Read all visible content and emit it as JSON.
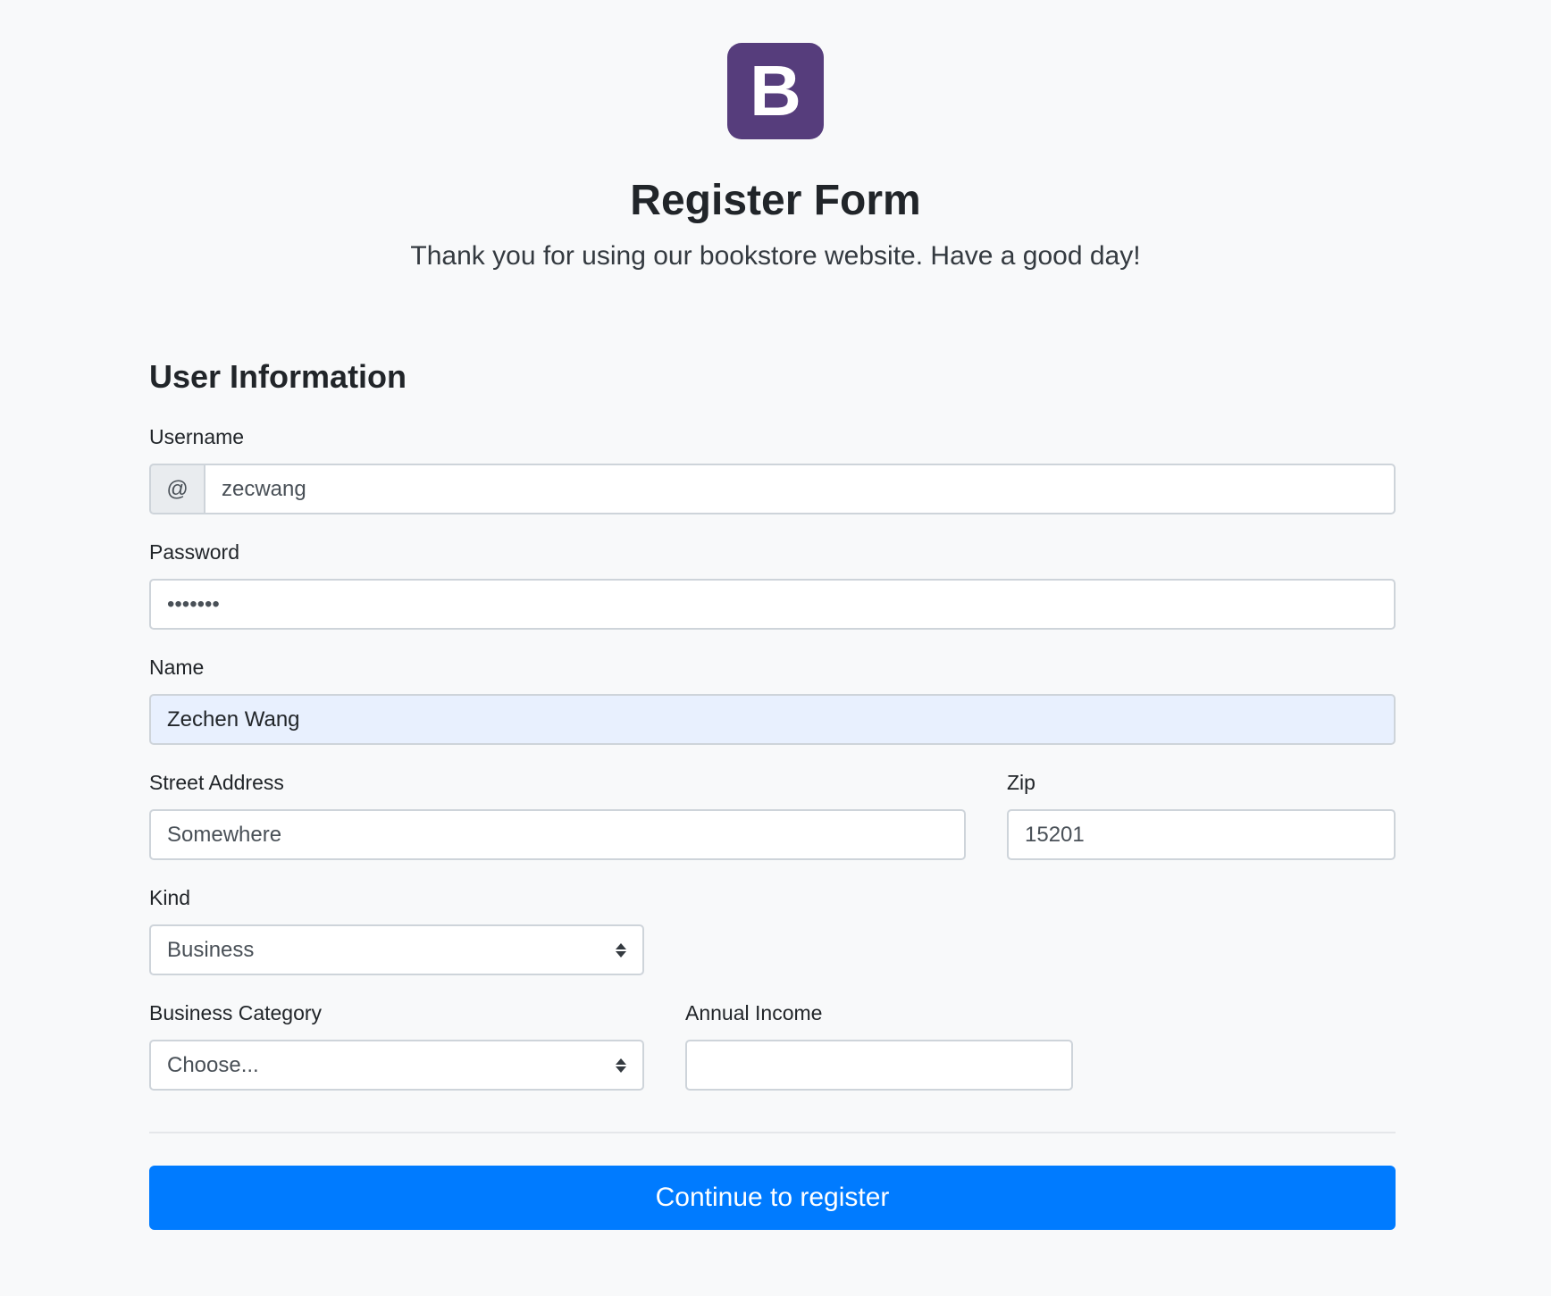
{
  "header": {
    "logo_letter": "B",
    "title": "Register Form",
    "subtitle": "Thank you for using our bookstore website. Have a good day!"
  },
  "section": {
    "title": "User Information"
  },
  "fields": {
    "username": {
      "label": "Username",
      "prefix": "@",
      "value": "zecwang"
    },
    "password": {
      "label": "Password",
      "value": "•••••••"
    },
    "name": {
      "label": "Name",
      "value": "Zechen Wang"
    },
    "street": {
      "label": "Street Address",
      "value": "Somewhere"
    },
    "zip": {
      "label": "Zip",
      "value": "15201"
    },
    "kind": {
      "label": "Kind",
      "value": "Business"
    },
    "business_category": {
      "label": "Business Category",
      "value": "Choose..."
    },
    "annual_income": {
      "label": "Annual Income",
      "value": ""
    }
  },
  "submit": {
    "label": "Continue to register"
  },
  "colors": {
    "brand": "#563d7c",
    "primary": "#007bff",
    "autofill": "#e8f0fe",
    "background": "#f8f9fa"
  },
  "icons": {
    "logo": "bootstrap-logo-icon",
    "select_arrows": "select-arrows-icon"
  }
}
